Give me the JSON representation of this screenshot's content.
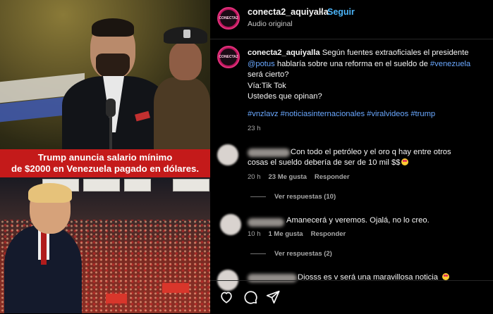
{
  "post": {
    "headline_line1": "Trump anuncia salario mínimo",
    "headline_line2": "de $2000 en Venezuela pagado en dólares.",
    "avatar_text": "CONECTA2"
  },
  "header": {
    "username": "conecta2_aquiyalla",
    "separator": "•",
    "follow_label": "Seguir",
    "audio_label": "Audio original"
  },
  "caption": {
    "username": "conecta2_aquiyalla",
    "text_part1": "Según fuentes extraoficiales el presidente",
    "mention": "@potus",
    "text_part2": "hablaría sobre una reforma en el sueldo de",
    "hashtag_inline": "#venezuela",
    "text_part3": "será cierto?",
    "line_via": "Vía:Tik Tok",
    "line_question": "Ustedes que opinan?",
    "hashtags": "#vnzlavz #noticiasinternacionales #viralvideos #trump",
    "time": "23 h"
  },
  "comments": [
    {
      "text_line1": "Con todo el petróleo y el oro q hay entre otros",
      "text_line2": "cosas el sueldo debería de ser de 10 mil $$",
      "time": "20 h",
      "likes": "23 Me gusta",
      "reply_label": "Responder",
      "replies_label": "Ver respuestas (10)"
    },
    {
      "text_line1": "Amanecerá y veremos. Ojalá, no lo creo.",
      "time": "10 h",
      "likes": "1 Me gusta",
      "reply_label": "Responder",
      "replies_label": "Ver respuestas (2)"
    },
    {
      "text_line1": "Diosss es v será una maravillosa noticia"
    }
  ],
  "actions": {
    "like_icon": "heart-icon",
    "comment_icon": "comment-icon",
    "share_icon": "send-icon"
  },
  "colors": {
    "accent_link": "#4cb5f9",
    "hashtag": "#6aa8ff",
    "headline_bg": "#c41a1a"
  }
}
